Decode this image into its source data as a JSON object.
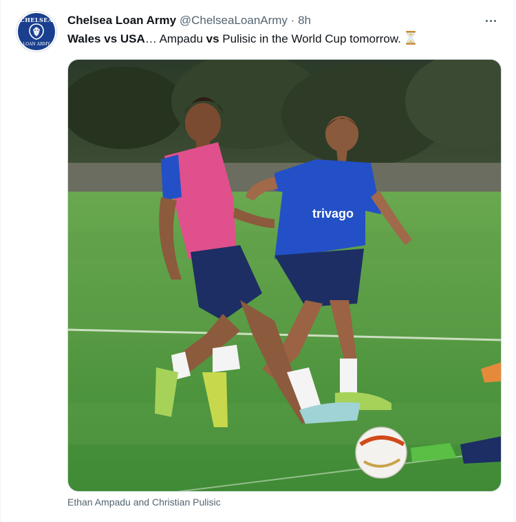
{
  "tweet": {
    "display_name": "Chelsea Loan Army",
    "handle": "@ChelseaLoanArmy",
    "separator": "·",
    "time": "8h",
    "text_parts": {
      "team_a": "Wales",
      "vs1": "vs",
      "team_b": "USA",
      "ellipsis": "… Ampadu ",
      "vs2": "vs",
      "rest": " Pulisic in the World Cup tomorrow."
    },
    "emoji_icon": "hourglass-icon",
    "caption": "Ethan Ampadu and Christian Pulisic"
  },
  "avatar": {
    "top_text": "CHELSEA",
    "bottom_text": "LOAN ARMY"
  },
  "photo": {
    "shirt_sponsor": "trivago"
  },
  "colors": {
    "text_primary": "#0f1419",
    "text_secondary": "#536471",
    "chelsea_blue": "#1a3f8f",
    "pitch_green": "#4a9a3a"
  }
}
